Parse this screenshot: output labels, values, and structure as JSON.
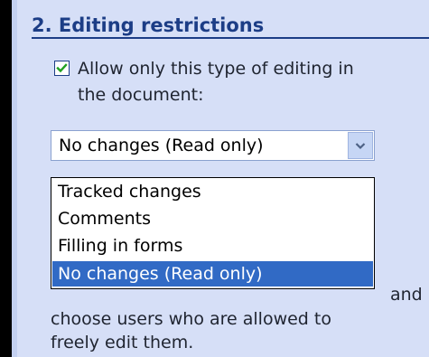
{
  "section": {
    "title": "2. Editing restrictions"
  },
  "restrict": {
    "checked": true,
    "label_line1": "Allow only this type of editing in",
    "label_line2": "the document:"
  },
  "combo": {
    "value": "No changes (Read only)"
  },
  "options": [
    {
      "label": "Tracked changes",
      "selected": false
    },
    {
      "label": "Comments",
      "selected": false
    },
    {
      "label": "Filling in forms",
      "selected": false
    },
    {
      "label": "No changes (Read only)",
      "selected": true
    }
  ],
  "exceptions": {
    "line1_tail": "and",
    "line2": "choose users who are allowed to",
    "line3": "freely edit them."
  },
  "colors": {
    "pane": "#d6dff7",
    "accent": "#1c3d86",
    "selection": "#316ac5",
    "checkmark": "#21a121"
  }
}
